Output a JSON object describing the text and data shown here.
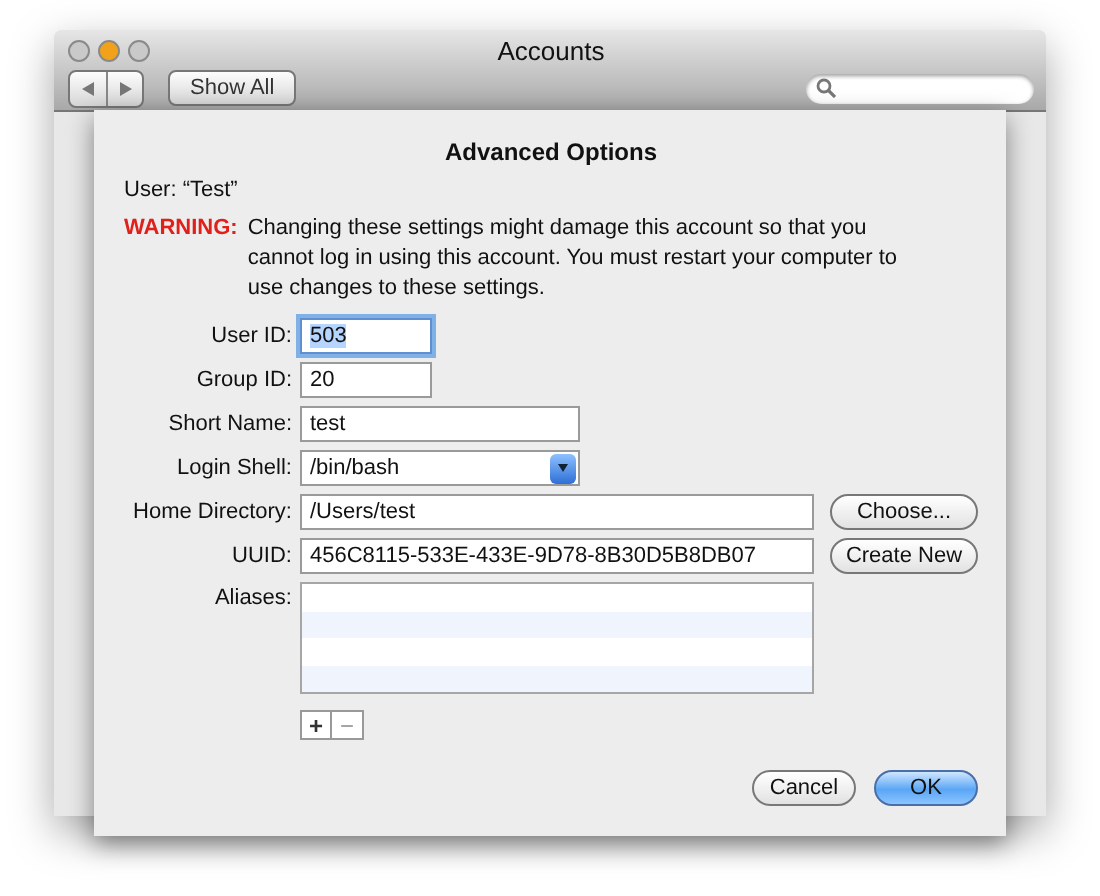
{
  "window": {
    "title": "Accounts",
    "show_all": "Show All"
  },
  "sheet": {
    "title": "Advanced Options",
    "user": "User: “Test”",
    "warning": {
      "label": "WARNING:",
      "text": "Changing these settings might damage this account so that you cannot log in using this account. You must restart your computer to use changes to these settings."
    },
    "fields": [
      {
        "kind": "number",
        "label": "User ID:",
        "value": "503",
        "focused": true
      },
      {
        "kind": "number",
        "label": "Group ID:",
        "value": "20",
        "focused": false
      },
      {
        "kind": "name",
        "label": "Short Name:",
        "value": "test",
        "focused": false
      },
      {
        "kind": "popup",
        "label": "Login Shell:",
        "value": "/bin/bash"
      },
      {
        "kind": "path",
        "label": "Home Directory:",
        "value": "/Users/test",
        "focused": false,
        "button": "Choose..."
      },
      {
        "kind": "path",
        "label": "UUID:",
        "value": "456C8115-533E-433E-9D78-8B30D5B8DB07",
        "focused": false,
        "button": "Create New"
      }
    ],
    "aliases": {
      "label": "Aliases:",
      "add": "+",
      "remove": "−"
    },
    "buttons": [
      {
        "label": "Cancel",
        "default": false
      },
      {
        "label": "OK",
        "default": true
      }
    ]
  }
}
